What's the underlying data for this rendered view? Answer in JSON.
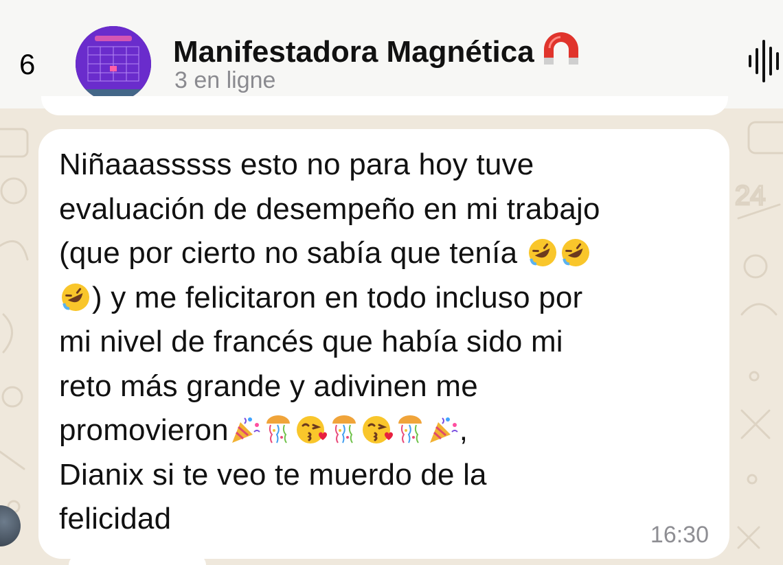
{
  "header": {
    "back_count": "6",
    "title": "Manifestadora Magnética",
    "title_emoji": "magnet-icon",
    "subtitle": "3 en ligne",
    "right_icon": "voice-wave-icon"
  },
  "message": {
    "lines": [
      "Niñaaasssss esto no para hoy tuve",
      "evaluación de desempeño en mi trabajo",
      "(que por cierto no sabía que tenía ",
      ") y me felicitaron en todo incluso por",
      "mi nivel de francés que había sido mi",
      "reto más grande y adivinen me",
      "promovieron",
      "Dianix si te veo te muerdo de la",
      "felicidad"
    ],
    "trailing_comma": ",",
    "timestamp": "16:30"
  },
  "colors": {
    "wallpaper": "#efe8dc",
    "bubble": "#ffffff",
    "header_bg": "#f7f7f5",
    "subtitle": "#8a8a8f",
    "magnet_red": "#e0342c"
  }
}
